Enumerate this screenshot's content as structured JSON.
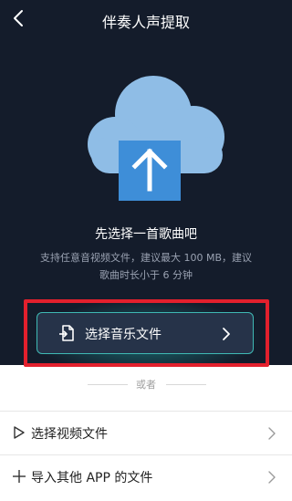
{
  "header": {
    "title": "伴奏人声提取"
  },
  "hero": {
    "heading": "先选择一首歌曲吧",
    "description": "支持任意音视频文件，建议最大 100 MB，建议歌曲时长小于 6 分钟"
  },
  "primary_action": {
    "label": "选择音乐文件"
  },
  "separator": {
    "text": "或者"
  },
  "options": [
    {
      "label": "选择视频文件"
    },
    {
      "label": "导入其他 APP 的文件"
    }
  ],
  "colors": {
    "background_dark": "#141c2b",
    "cloud": "#8fbde6",
    "arrow_box": "#3e8ed8",
    "button_fill": "#263349",
    "button_border": "#3fb9b4",
    "highlight": "#e3202d"
  }
}
